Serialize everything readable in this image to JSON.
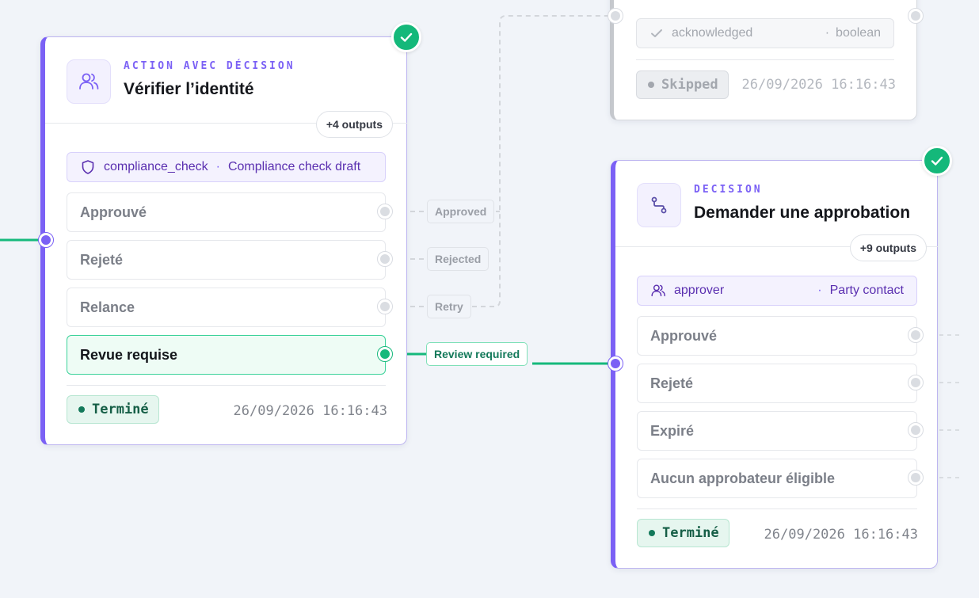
{
  "canvas": {
    "edges": [
      {
        "id": "in-edge",
        "color": "#16b97c"
      },
      {
        "id": "approved-edge",
        "color": "#d3d6db"
      },
      {
        "id": "rejected-edge",
        "color": "#d3d6db"
      },
      {
        "id": "retry-edge",
        "color": "#d3d6db"
      },
      {
        "id": "review-edge",
        "color": "#16b97c"
      }
    ],
    "edge_labels": [
      {
        "label": "Approved",
        "active": false
      },
      {
        "label": "Rejected",
        "active": false
      },
      {
        "label": "Retry",
        "active": false
      },
      {
        "label": "Review required",
        "active": true
      }
    ]
  },
  "node_verify": {
    "kind": "ACTION AVEC DÉCISION",
    "title": "Vérifier l’identité",
    "icon": "users-icon",
    "outputs_pill": "+4 outputs",
    "context": {
      "icon": "shield-icon",
      "name": "compliance_check",
      "sep": "·",
      "value": "Compliance check draft"
    },
    "branches": [
      {
        "label": "Approuvé",
        "selected": false
      },
      {
        "label": "Rejeté",
        "selected": false
      },
      {
        "label": "Relance",
        "selected": false
      },
      {
        "label": "Revue requise",
        "selected": true
      }
    ],
    "status": "Terminé",
    "timestamp": "26/09/2026 16:16:43",
    "completed": true
  },
  "node_skipped": {
    "field": {
      "icon": "check-icon",
      "name": "acknowledged",
      "sep": "·",
      "type": "boolean"
    },
    "status": "Skipped",
    "timestamp": "26/09/2026 16:16:43"
  },
  "node_approval": {
    "kind": "DECISION",
    "title": "Demander une approbation",
    "icon": "route-icon",
    "outputs_pill": "+9 outputs",
    "context": {
      "icon": "users-icon",
      "name": "approver",
      "sep": "·",
      "value": "Party contact"
    },
    "branches": [
      {
        "label": "Approuvé"
      },
      {
        "label": "Rejeté"
      },
      {
        "label": "Expiré"
      },
      {
        "label": "Aucun approbateur éligible"
      }
    ],
    "status": "Terminé",
    "timestamp": "26/09/2026 16:16:43",
    "completed": true
  },
  "colors": {
    "accent": "#7b61f5",
    "success": "#14b87a",
    "background": "#f1f4f9"
  }
}
